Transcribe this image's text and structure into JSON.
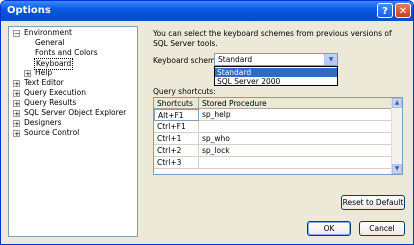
{
  "window": {
    "title": "Options"
  },
  "tree": {
    "environment": "Environment",
    "general": "General",
    "fonts_colors": "Fonts and Colors",
    "keyboard": "Keyboard",
    "help": "Help",
    "text_editor": "Text Editor",
    "query_execution": "Query Execution",
    "query_results": "Query Results",
    "object_explorer": "SQL Server Object Explorer",
    "designers": "Designers",
    "source_control": "Source Control"
  },
  "content": {
    "description": "You can select the keyboard schemes from previous versions of SQL Server tools.",
    "scheme_label": "Keyboard scheme:",
    "scheme_value": "Standard",
    "scheme_options": [
      "Standard",
      "SQL Server 2000"
    ],
    "query_shortcuts_label": "Query shortcuts:"
  },
  "grid": {
    "headers": [
      "Shortcuts",
      "Stored Procedure"
    ],
    "rows": [
      {
        "shortcut": "Alt+F1",
        "proc": "sp_help"
      },
      {
        "shortcut": "Ctrl+F1",
        "proc": ""
      },
      {
        "shortcut": "Ctrl+1",
        "proc": "sp_who"
      },
      {
        "shortcut": "Ctrl+2",
        "proc": "sp_lock"
      },
      {
        "shortcut": "Ctrl+3",
        "proc": ""
      }
    ]
  },
  "buttons": {
    "reset": "Reset to Default",
    "ok": "OK",
    "cancel": "Cancel"
  },
  "icons": {
    "help": "?",
    "close": "✕",
    "plus": "+",
    "minus": "−",
    "dropdown": "▼",
    "scroll_up": "▲",
    "scroll_down": "▼"
  }
}
